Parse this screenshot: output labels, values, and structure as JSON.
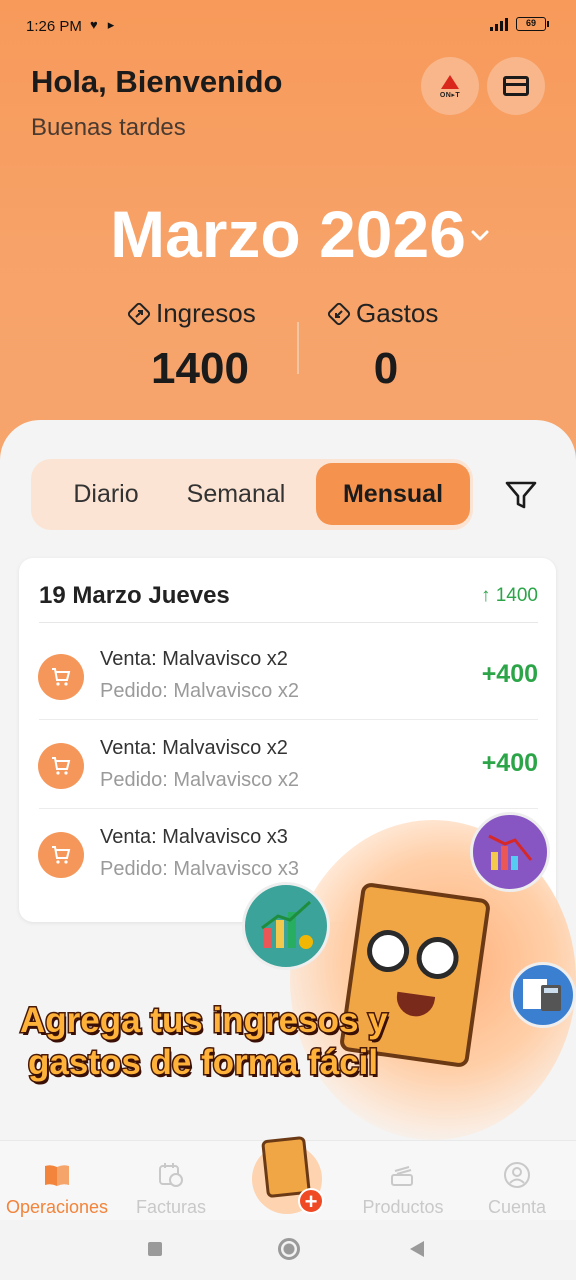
{
  "status_bar": {
    "time": "1:26 PM",
    "battery": "69"
  },
  "header": {
    "greeting": "Hola, Bienvenido",
    "subgreeting": "Buenas tardes",
    "onit_label": "ON▸T",
    "month_label": "Marzo 2026",
    "income_label": "Ingresos",
    "income_value": "1400",
    "expense_label": "Gastos",
    "expense_value": "0"
  },
  "segments": {
    "daily": "Diario",
    "weekly": "Semanal",
    "monthly": "Mensual",
    "selected": "Mensual"
  },
  "day_group": {
    "title": "19 Marzo Jueves",
    "total": "↑ 1400",
    "rows": [
      {
        "line1": "Venta: Malvavisco x2",
        "line2": "Pedido: Malvavisco x2",
        "amount": "+400"
      },
      {
        "line1": "Venta: Malvavisco x2",
        "line2": "Pedido: Malvavisco x2",
        "amount": "+400"
      },
      {
        "line1": "Venta: Malvavisco x3",
        "line2": "Pedido: Malvavisco x3",
        "amount": ""
      }
    ]
  },
  "promo": {
    "line1": "Agrega tus ingresos y",
    "line2": "gastos de forma fácil"
  },
  "bottom_nav": {
    "items": [
      {
        "label": "Operaciones",
        "icon": "book-open-icon",
        "active": true
      },
      {
        "label": "Facturas",
        "icon": "calendar-clock-icon",
        "active": false
      },
      {
        "label": "Productos",
        "icon": "products-icon",
        "active": false
      },
      {
        "label": "Cuenta",
        "icon": "user-icon",
        "active": false
      }
    ]
  },
  "colors": {
    "accent": "#f5934e",
    "income_green": "#2ba548",
    "header_bg": "#f79a5a"
  }
}
